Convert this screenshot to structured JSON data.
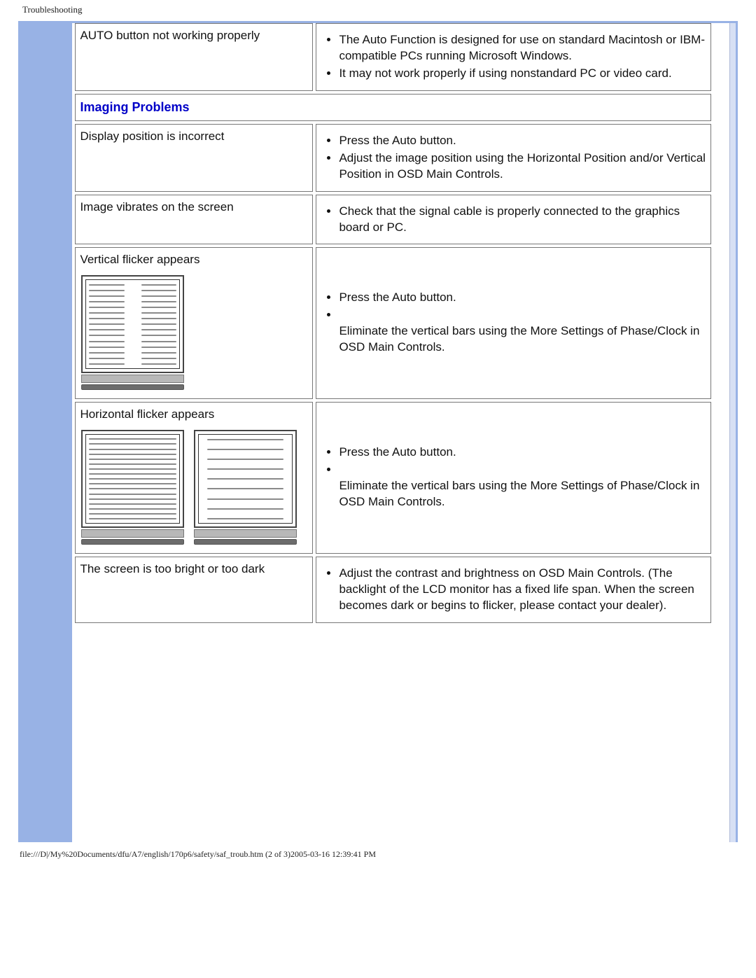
{
  "page_title": "Troubleshooting",
  "footer": "file:///D|/My%20Documents/dfu/A7/english/170p6/safety/saf_troub.htm (2 of 3)2005-03-16 12:39:41 PM",
  "row1": {
    "left": "AUTO button not working properly",
    "b1": "The Auto Function is designed for use on standard Macintosh or IBM-compatible PCs running Microsoft Windows.",
    "b2": "It may not work properly if using nonstandard PC or video card."
  },
  "section": "Imaging Problems",
  "row3": {
    "left": "Display position is incorrect",
    "b1": "Press the Auto button.",
    "b2": "Adjust the image position using the Horizontal Position and/or Vertical Position in OSD Main Controls."
  },
  "row4": {
    "left": "Image vibrates on the screen",
    "b1": "Check that the signal cable is properly connected to the graphics board or PC."
  },
  "row5": {
    "left": "Vertical flicker appears",
    "b1": "Press the Auto button.",
    "b2": "Eliminate the vertical bars using the More Settings of Phase/Clock in OSD Main Controls."
  },
  "row6": {
    "left": "Horizontal flicker appears",
    "b1": "Press the Auto button.",
    "b2": "Eliminate the vertical bars using the More Settings of Phase/Clock in OSD Main Controls."
  },
  "row7": {
    "left": "The screen is too bright or too dark",
    "b1": "Adjust the contrast and brightness on OSD Main Controls. (The backlight of the LCD monitor has a fixed life span. When the screen becomes dark or begins to flicker, please contact your dealer)."
  }
}
